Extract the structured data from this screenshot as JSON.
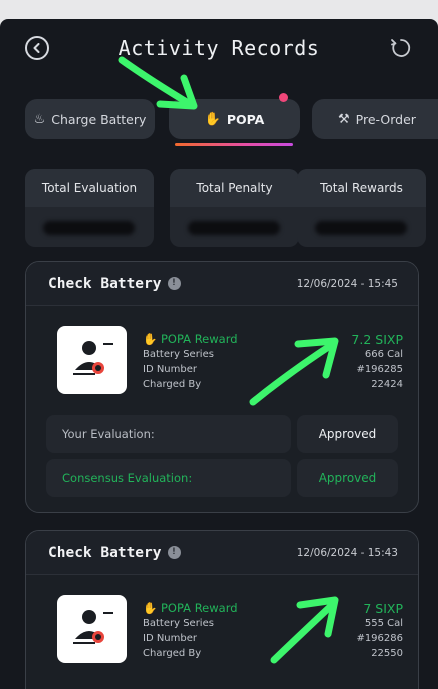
{
  "header": {
    "title": "Activity Records"
  },
  "tabs": [
    {
      "label": "Charge Battery",
      "icon": "battery-icon"
    },
    {
      "label": "POPA",
      "icon": "handshake-icon"
    },
    {
      "label": "Pre-Order",
      "icon": "tools-icon"
    }
  ],
  "stats": [
    {
      "label": "Total Evaluation"
    },
    {
      "label": "Total Penalty"
    },
    {
      "label": "Total Rewards"
    }
  ],
  "cards": [
    {
      "title": "Check Battery",
      "date": "12/06/2024 - 15:45",
      "reward_label": "POPA Reward",
      "reward_amount": "7.2 SIXP",
      "battery_series_label": "Battery Series",
      "battery_series_value": "666 Cal",
      "id_label": "ID Number",
      "id_value": "#196285",
      "charged_by_label": "Charged By",
      "charged_by_value": "22424",
      "your_eval_label": "Your Evaluation:",
      "your_eval_value": "Approved",
      "consensus_label": "Consensus Evaluation:",
      "consensus_value": "Approved"
    },
    {
      "title": "Check Battery",
      "date": "12/06/2024 - 15:43",
      "reward_label": "POPA Reward",
      "reward_amount": "7 SIXP",
      "battery_series_label": "Battery Series",
      "battery_series_value": "555 Cal",
      "id_label": "ID Number",
      "id_value": "#196286",
      "charged_by_label": "Charged By",
      "charged_by_value": "22550"
    }
  ],
  "colors": {
    "accent_green": "#22b35a",
    "annotation_green": "#3df56c",
    "tab_dot": "#f0477a"
  }
}
